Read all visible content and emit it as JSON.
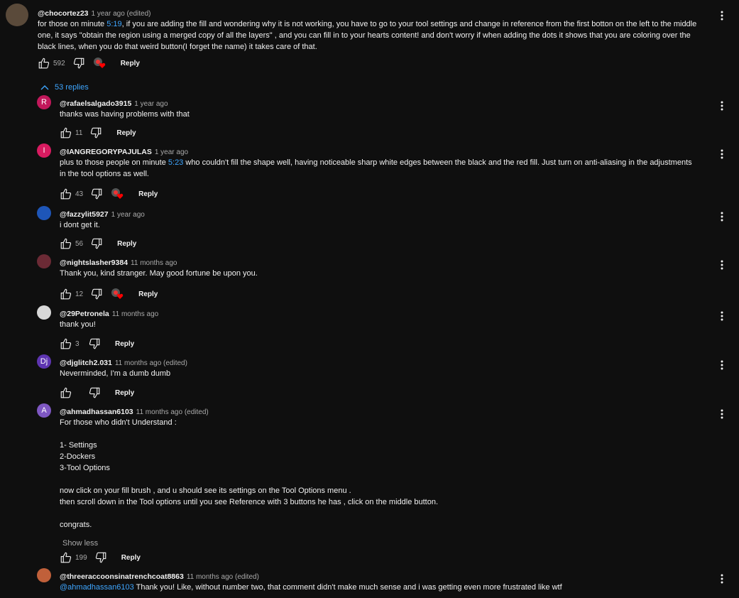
{
  "colors": {
    "background": "#0f0f0f",
    "link": "#3ea6ff",
    "text": "#f1f1f1",
    "muted": "#aaaaaa",
    "heart": "#ff0000"
  },
  "thread": {
    "top_comment": {
      "author": "@chocortez23",
      "time": "1 year ago (edited)",
      "lines": [
        [
          {
            "t": "for those on minute "
          },
          {
            "t": "5:19",
            "link": true
          },
          {
            "t": ", if you are adding the fill and wondering why it is not working, you have to go to your tool settings and change in reference from the first botton on the left to the middle"
          }
        ],
        [
          {
            "t": "one, it says \"obtain the region using a merged copy of all the layers\" , and you can fill in to your hearts content! and don't worry if when adding the dots it shows that you are coloring over the"
          }
        ],
        [
          {
            "t": "black lines, when you do that weird button(I forget the name) it takes care of that."
          }
        ]
      ],
      "likes": "592",
      "hearted": true,
      "reply_label": "Reply",
      "avatar": {
        "type": "photo",
        "color": "#5a4a3a"
      }
    },
    "replies_toggle": {
      "icon": "chevron-up-icon",
      "label": "53 replies"
    },
    "replies": [
      {
        "author": "@rafaelsalgado3915",
        "time": "1 year ago",
        "lines": [
          [
            {
              "t": "thanks was having problems with that"
            }
          ]
        ],
        "likes": "11",
        "hearted": false,
        "reply_label": "Reply",
        "avatar": {
          "letter": "R",
          "color": "#c2185b"
        }
      },
      {
        "author": "@IANGREGORYPAJULAS",
        "time": "1 year ago",
        "lines": [
          [
            {
              "t": "plus to those people on minute "
            },
            {
              "t": "5:23",
              "link": true
            },
            {
              "t": " who couldn't fill the shape well, having noticeable sharp white edges between the black and the red fill. Just turn on anti-aliasing in the adjustments"
            }
          ],
          [
            {
              "t": "in the tool options as well."
            }
          ]
        ],
        "likes": "43",
        "hearted": true,
        "reply_label": "Reply",
        "avatar": {
          "letter": "I",
          "color": "#d81b60"
        }
      },
      {
        "author": "@fazzylit5927",
        "time": "1 year ago",
        "lines": [
          [
            {
              "t": "i dont get it."
            }
          ]
        ],
        "likes": "56",
        "hearted": false,
        "reply_label": "Reply",
        "avatar": {
          "letter": "",
          "color": "#1e56b8"
        }
      },
      {
        "author": "@nightslasher9384",
        "time": "11 months ago",
        "lines": [
          [
            {
              "t": "Thank you, kind stranger. May good fortune be upon you."
            }
          ]
        ],
        "likes": "12",
        "hearted": true,
        "reply_label": "Reply",
        "avatar": {
          "letter": "",
          "color": "#6b2a35"
        }
      },
      {
        "author": "@29Petronela",
        "time": "11 months ago",
        "lines": [
          [
            {
              "t": "thank you!"
            }
          ]
        ],
        "likes": "3",
        "hearted": false,
        "reply_label": "Reply",
        "avatar": {
          "letter": "",
          "color": "#d8d8d8"
        }
      },
      {
        "author": "@djglitch2.031",
        "time": "11 months ago (edited)",
        "lines": [
          [
            {
              "t": "Neverminded, I'm a dumb dumb"
            }
          ]
        ],
        "likes": "",
        "hearted": false,
        "reply_label": "Reply",
        "avatar": {
          "letter": "Dj",
          "color": "#5e35b1"
        }
      },
      {
        "author": "@ahmadhassan6103",
        "time": "11 months ago (edited)",
        "lines": [
          [
            {
              "t": "For those who didn't Understand :"
            }
          ],
          [
            {
              "t": ""
            }
          ],
          [
            {
              "t": "1- Settings"
            }
          ],
          [
            {
              "t": "2-Dockers"
            }
          ],
          [
            {
              "t": "3-Tool Options"
            }
          ],
          [
            {
              "t": ""
            }
          ],
          [
            {
              "t": "now click on your fill brush , and u should see its settings on the Tool Options menu ."
            }
          ],
          [
            {
              "t": "then scroll down in the Tool options until you see Reference with 3 buttons he has , click on the middle button."
            }
          ],
          [
            {
              "t": ""
            }
          ],
          [
            {
              "t": "congrats."
            }
          ]
        ],
        "show_less": "Show less",
        "likes": "199",
        "hearted": false,
        "reply_label": "Reply",
        "avatar": {
          "letter": "A",
          "color": "#7e57c2"
        }
      },
      {
        "author": "@threeraccoonsinatrenchcoat8863",
        "time": "11 months ago (edited)",
        "lines": [
          [
            {
              "t": "@ahmadhassan6103",
              "link": true
            },
            {
              "t": "  Thank you!  Like, without number two, that comment didn't make much sense and i was getting even more frustrated like wtf"
            }
          ]
        ],
        "likes": null,
        "hearted": false,
        "reply_label": "Reply",
        "avatar": {
          "letter": "",
          "color": "#c0603a"
        }
      }
    ]
  }
}
